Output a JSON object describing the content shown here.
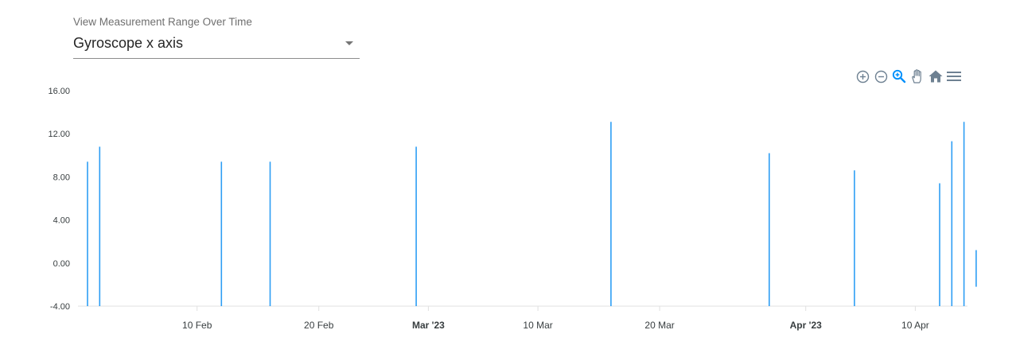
{
  "selector": {
    "label": "View Measurement Range Over Time",
    "value": "Gyroscope x axis"
  },
  "toolbar": {
    "icons": [
      "zoom-in-icon",
      "zoom-out-icon",
      "selection-zoom-icon",
      "pan-hand-icon",
      "home-reset-icon",
      "menu-icon"
    ],
    "active_icon": "selection-zoom-icon",
    "active_color": "#008ffb",
    "icon_color": "#6e8192"
  },
  "chart_data": {
    "type": "range-bar",
    "series_color": "#2e9ef4",
    "ylim": [
      -4,
      16
    ],
    "yticks": [
      "16.00",
      "12.00",
      "8.00",
      "4.00",
      "0.00",
      "-4.00"
    ],
    "ytick_values": [
      16,
      12,
      8,
      4,
      0,
      -4
    ],
    "xlim": [
      "2023-02-01",
      "2023-04-16"
    ],
    "xticks": [
      {
        "date": "2023-02-10",
        "label": "10 Feb",
        "bold": false
      },
      {
        "date": "2023-02-20",
        "label": "20 Feb",
        "bold": false
      },
      {
        "date": "2023-03-01",
        "label": "Mar '23",
        "bold": true
      },
      {
        "date": "2023-03-10",
        "label": "10 Mar",
        "bold": false
      },
      {
        "date": "2023-03-20",
        "label": "20 Mar",
        "bold": false
      },
      {
        "date": "2023-04-01",
        "label": "Apr '23",
        "bold": true
      },
      {
        "date": "2023-04-10",
        "label": "10 Apr",
        "bold": false
      }
    ],
    "ranges": [
      {
        "date": "2023-02-01",
        "low": -4.0,
        "high": 9.4
      },
      {
        "date": "2023-02-02",
        "low": -4.0,
        "high": 10.8
      },
      {
        "date": "2023-02-12",
        "low": -4.0,
        "high": 9.4
      },
      {
        "date": "2023-02-16",
        "low": -4.0,
        "high": 9.4
      },
      {
        "date": "2023-02-28",
        "low": -4.0,
        "high": 10.8
      },
      {
        "date": "2023-03-16",
        "low": -4.0,
        "high": 13.1
      },
      {
        "date": "2023-03-29",
        "low": -4.0,
        "high": 10.2
      },
      {
        "date": "2023-04-05",
        "low": -4.0,
        "high": 8.6
      },
      {
        "date": "2023-04-12",
        "low": -4.0,
        "high": 7.4
      },
      {
        "date": "2023-04-13",
        "low": -4.0,
        "high": 11.3
      },
      {
        "date": "2023-04-14",
        "low": -4.0,
        "high": 13.1
      },
      {
        "date": "2023-04-15",
        "low": -2.2,
        "high": 1.2
      }
    ]
  }
}
